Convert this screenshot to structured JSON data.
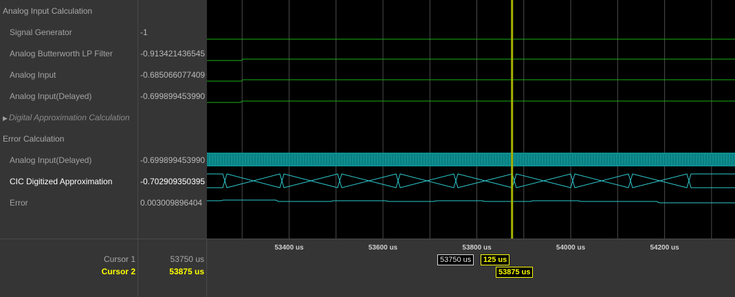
{
  "signals": [
    {
      "kind": "group",
      "name": "Analog Input Calculation",
      "value": ""
    },
    {
      "kind": "signal",
      "name": "Signal Generator",
      "value": "-1"
    },
    {
      "kind": "signal",
      "name": "Analog Butterworth LP Filter",
      "value": "-0.913421436545"
    },
    {
      "kind": "signal",
      "name": "Analog Input",
      "value": "-0.685066077409"
    },
    {
      "kind": "signal",
      "name": "Analog Input(Delayed)",
      "value": "-0.699899453990"
    },
    {
      "kind": "collapsed",
      "name": "Digital Approximation Calculation",
      "value": ""
    },
    {
      "kind": "group",
      "name": "Error Calculation",
      "value": ""
    },
    {
      "kind": "signal",
      "name": "Analog Input(Delayed)",
      "value": "-0.699899453990"
    },
    {
      "kind": "signal-selected",
      "name": "CIC Digitized Approximation",
      "value": "-0.702909350395"
    },
    {
      "kind": "signal",
      "name": "Error",
      "value": "0.003009896404"
    }
  ],
  "axis": {
    "ticks": [
      "53400 us",
      "53600 us",
      "53800 us",
      "54000 us",
      "54200 us"
    ],
    "tick_values_us": [
      53400,
      53600,
      53800,
      54000,
      54200
    ],
    "visible_range_us": [
      53225,
      54350
    ]
  },
  "cursors": {
    "cursor1": {
      "label": "Cursor 1",
      "value": "53750 us",
      "time_us": 53750
    },
    "cursor2": {
      "label": "Cursor 2",
      "value": "53875 us",
      "time_us": 53875
    },
    "delta": "125 us"
  },
  "colors": {
    "analog_trace": "#19b219",
    "digital_trace": "#2ecbd0",
    "bus_fill": "#0e8e91",
    "cursor": "#a8b400",
    "grid": "#4d4d4d"
  }
}
